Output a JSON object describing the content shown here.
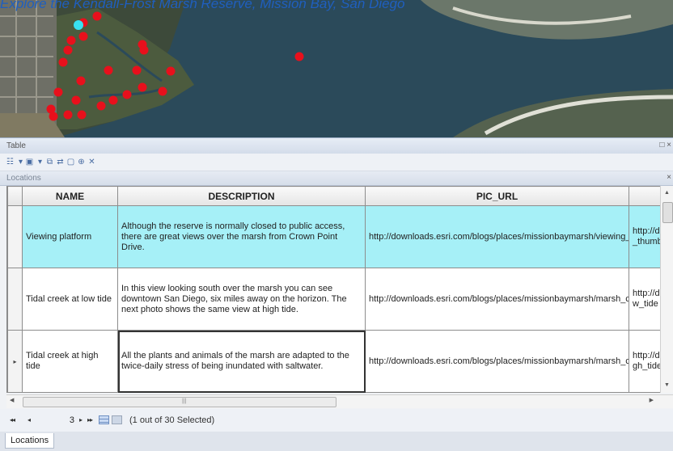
{
  "map": {
    "caption": "Explore the Kendall-Frost Marsh Reserve, Mission Bay, San Diego"
  },
  "window": {
    "title": "Table",
    "close_label": "□ ×"
  },
  "toolbar": {
    "icons": [
      "table-options-icon",
      "related-tables-icon",
      "select-by-attributes-icon",
      "switch-selection-icon",
      "clear-selection-icon",
      "zoom-to-selected-icon",
      "delete-selected-icon"
    ]
  },
  "table_tab": {
    "title": "Locations",
    "close_label": "×"
  },
  "table": {
    "columns": [
      "NAME",
      "DESCRIPTION",
      "PIC_URL",
      ""
    ],
    "rows": [
      {
        "name": "Viewing platform",
        "description": "Although the reserve is normally closed to public access, there are great views over the marsh from Crown Point Drive.",
        "pic_url": "http://downloads.esri.com/blogs/places/missionbaymarsh/viewing_platform.jpg",
        "extra": "http://d _thumb",
        "selected": true,
        "current": false,
        "marker": ""
      },
      {
        "name": "Tidal creek at low tide",
        "description": "In this view looking south over the marsh you can see downtown San Diego, six miles away on the horizon. The next photo shows the same view at high tide.",
        "pic_url": "http://downloads.esri.com/blogs/places/missionbaymarsh/marsh_creek_low_tide.jpg",
        "extra": "http://d w_tide",
        "selected": false,
        "current": false,
        "marker": ""
      },
      {
        "name": "Tidal creek at high tide",
        "description": "All the plants and animals of the marsh are adapted to the twice-daily stress of being inundated with saltwater.",
        "pic_url": "http://downloads.esri.com/blogs/places/missionbaymarsh/marsh_creek_high_tide.jpg",
        "extra": "http://d gh_tide",
        "selected": false,
        "current": true,
        "marker": "▸"
      }
    ]
  },
  "navigation": {
    "first": "◂◂",
    "prev": "◂",
    "record": "3",
    "next": "▸",
    "last": "▸▸",
    "status": "(1 out of 30 Selected)"
  },
  "bottom_tab": "Locations",
  "colors": {
    "selected_row": "#a6f0f7",
    "marker": "#e8101c",
    "highlight_marker": "#38e0f0"
  }
}
